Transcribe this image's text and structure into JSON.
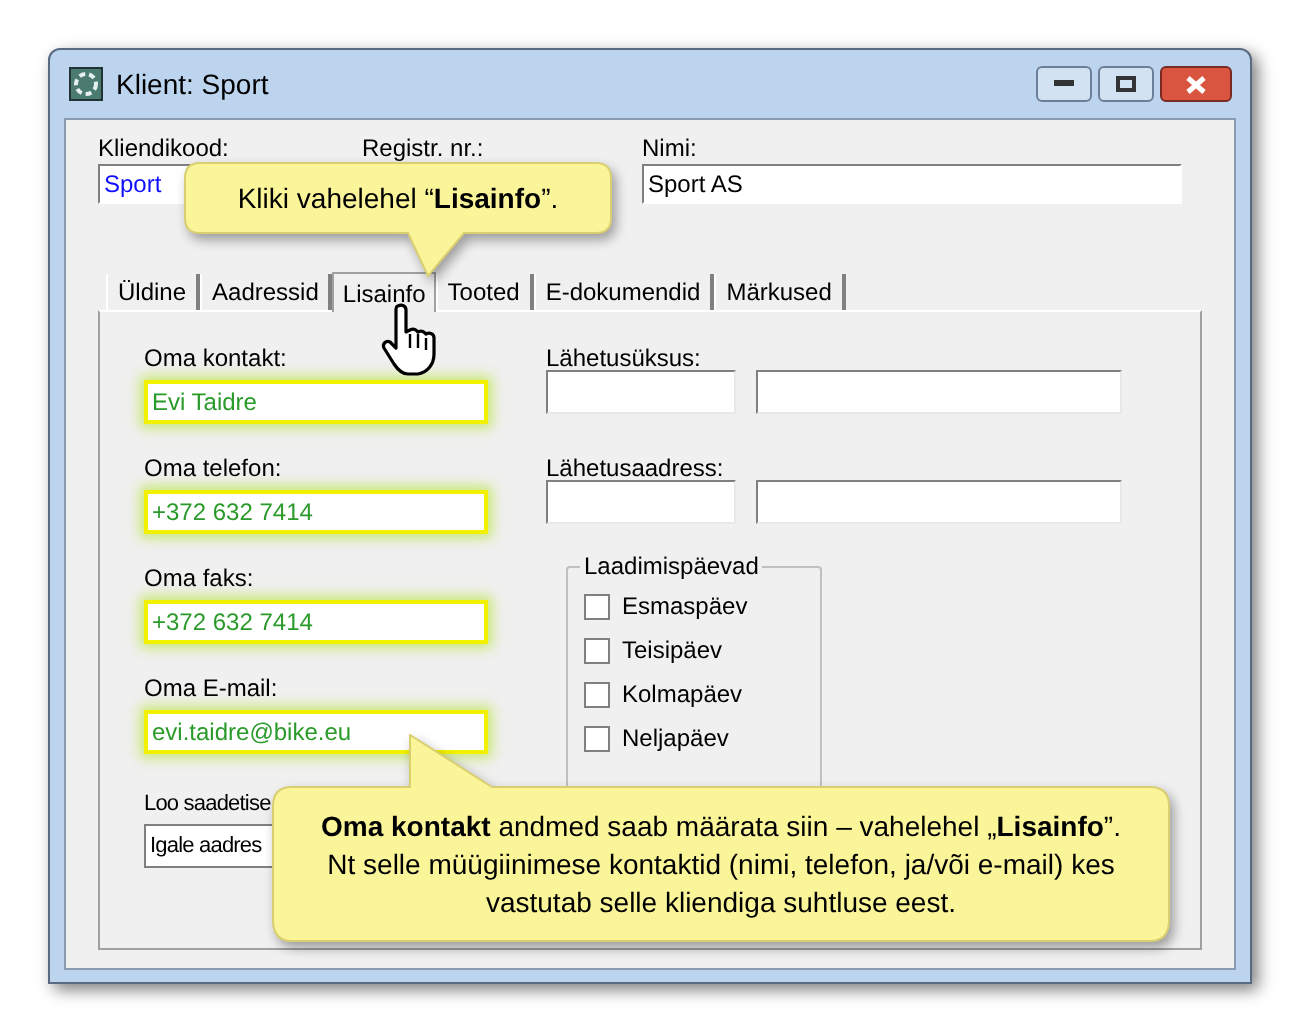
{
  "window": {
    "title": "Klient: Sport"
  },
  "header_fields": [
    {
      "label": "Kliendikood:",
      "value": "Sport",
      "kind": "code"
    },
    {
      "label": "Registr. nr.:",
      "kind": "text"
    },
    {
      "label": "Nimi:",
      "value": "Sport AS",
      "kind": "text"
    }
  ],
  "tabs": [
    {
      "label": "Üldine",
      "selected": false
    },
    {
      "label": "Aadressid",
      "selected": false
    },
    {
      "label": "Lisainfo",
      "selected": true
    },
    {
      "label": "Tooted",
      "selected": false
    },
    {
      "label": "E-dokumendid",
      "selected": false
    },
    {
      "label": "Märkused",
      "selected": false
    }
  ],
  "contact_fields": [
    {
      "label": "Oma kontakt:",
      "value": "Evi Taidre",
      "highlighted": true
    },
    {
      "label": "Oma telefon:",
      "value": "+372 632 7414",
      "highlighted": true
    },
    {
      "label": "Oma faks:",
      "value": "+372 632 7414",
      "highlighted": true
    },
    {
      "label": "Oma E-mail:",
      "value": "evi.taidre@bike.eu",
      "highlighted": true
    }
  ],
  "shipment_option": {
    "label": "Loo saadetise",
    "value": "Igale aadres"
  },
  "shipping_fields": [
    {
      "label": "Lähetusüksus:"
    },
    {
      "label": "Lähetusaadress:"
    }
  ],
  "delivery_days": {
    "title": "Laadimispäevad",
    "days": [
      {
        "label": "Esmaspäev",
        "checked": false
      },
      {
        "label": "Teisipäev",
        "checked": false
      },
      {
        "label": "Kolmapäev",
        "checked": false
      },
      {
        "label": "Neljapäev",
        "checked": false
      }
    ]
  },
  "callouts": [
    {
      "text": "Kliki vahelehel “**Lisainfo**”."
    },
    {
      "text": "**Oma kontakt** andmed saab määrata siin – vahelehel „**Lisainfo**”. Nt selle müügiinimese kontaktid (nimi, telefon, ja/või e-mail) kes vastutab selle kliendiga suhtluse eest."
    }
  ]
}
